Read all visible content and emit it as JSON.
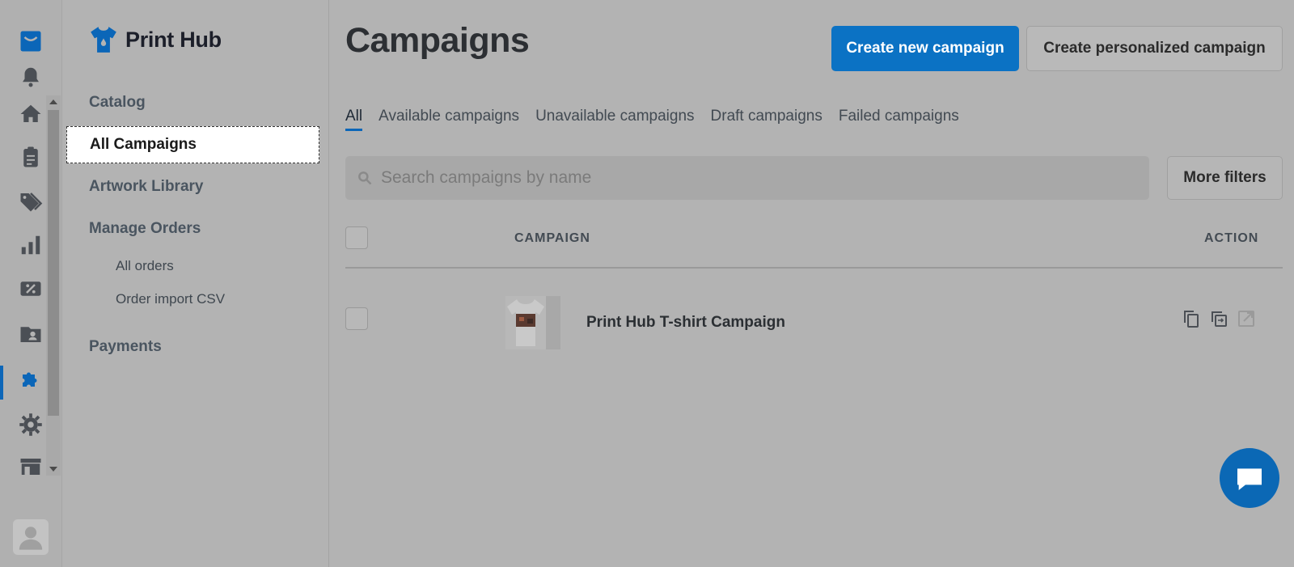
{
  "brand": {
    "name": "Print Hub"
  },
  "sidebar": {
    "items": [
      {
        "label": "Catalog"
      },
      {
        "label": "All Campaigns"
      },
      {
        "label": "Artwork Library"
      },
      {
        "label": "Manage Orders"
      },
      {
        "label": "Payments"
      }
    ],
    "subitems": [
      {
        "label": "All orders"
      },
      {
        "label": "Order import CSV"
      }
    ]
  },
  "rail": {
    "icons": [
      "inbox-icon",
      "bell-icon",
      "home-icon",
      "clipboard-icon",
      "tag-icon",
      "bar-chart-icon",
      "discount-icon",
      "folder-user-icon",
      "puzzle-icon",
      "gear-icon",
      "store-icon"
    ],
    "active": "puzzle-icon"
  },
  "main": {
    "title": "Campaigns",
    "create_button": "Create new campaign",
    "personalized_button": "Create personalized campaign",
    "tabs": [
      {
        "label": "All",
        "active": true
      },
      {
        "label": "Available campaigns"
      },
      {
        "label": "Unavailable campaigns"
      },
      {
        "label": "Draft campaigns"
      },
      {
        "label": "Failed campaigns"
      }
    ],
    "search": {
      "placeholder": "Search campaigns by name",
      "value": ""
    },
    "filters_button": "More filters",
    "table": {
      "headers": {
        "campaign": "CAMPAIGN",
        "action": "ACTION"
      },
      "rows": [
        {
          "name": "Print Hub T-shirt Campaign"
        }
      ]
    }
  },
  "colors": {
    "accent": "#0b72c4",
    "overlay": "#b3b3b3"
  }
}
